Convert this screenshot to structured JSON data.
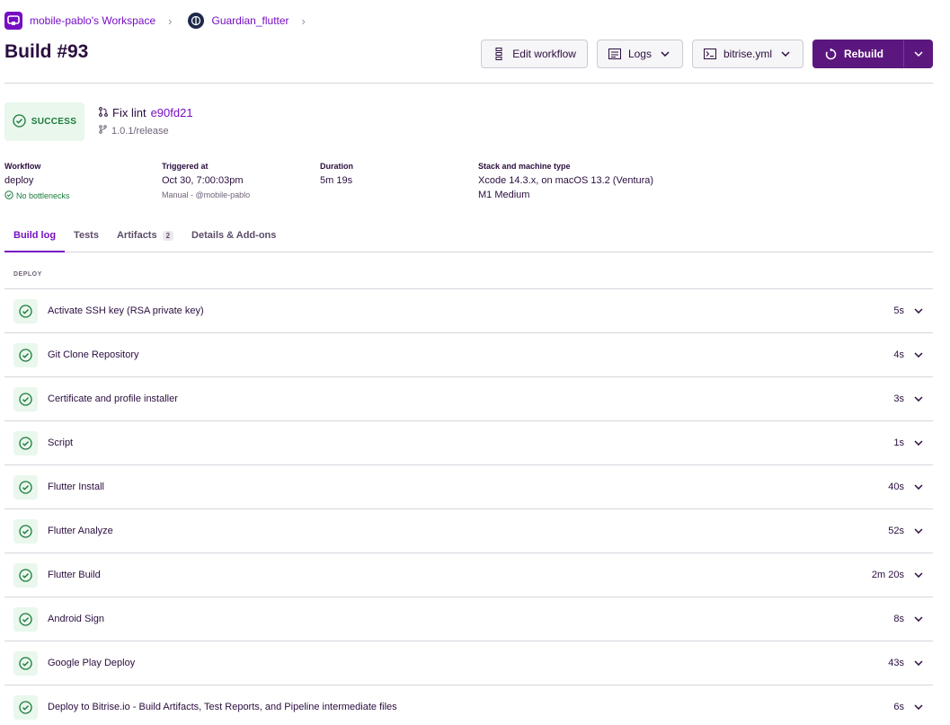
{
  "breadcrumb": {
    "workspace": "mobile-pablo's Workspace",
    "project": "Guardian_flutter"
  },
  "header": {
    "title": "Build #93",
    "edit_workflow": "Edit workflow",
    "logs": "Logs",
    "bitrise_yml": "bitrise.yml",
    "rebuild": "Rebuild"
  },
  "status": {
    "label": "SUCCESS",
    "commit_message": "Fix lint",
    "commit_hash": "e90fd21",
    "branch": "1.0.1/release"
  },
  "meta": {
    "workflow_label": "Workflow",
    "workflow_value": "deploy",
    "workflow_sub": "No bottlenecks",
    "triggered_label": "Triggered at",
    "triggered_value": "Oct 30, 7:00:03pm",
    "triggered_sub": "Manual - @mobile-pablo",
    "duration_label": "Duration",
    "duration_value": "5m 19s",
    "stack_label": "Stack and machine type",
    "stack_value": "Xcode 14.3.x, on macOS 13.2 (Ventura)",
    "machine_value": "M1 Medium"
  },
  "tabs": [
    {
      "label": "Build log",
      "active": true
    },
    {
      "label": "Tests"
    },
    {
      "label": "Artifacts",
      "count": "2"
    },
    {
      "label": "Details & Add-ons"
    }
  ],
  "section_label": "DEPLOY",
  "steps": [
    {
      "name": "Activate SSH key (RSA private key)",
      "duration": "5s"
    },
    {
      "name": "Git Clone Repository",
      "duration": "4s"
    },
    {
      "name": "Certificate and profile installer",
      "duration": "3s"
    },
    {
      "name": "Script",
      "duration": "1s"
    },
    {
      "name": "Flutter Install",
      "duration": "40s"
    },
    {
      "name": "Flutter Analyze",
      "duration": "52s"
    },
    {
      "name": "Flutter Build",
      "duration": "2m 20s"
    },
    {
      "name": "Android Sign",
      "duration": "8s"
    },
    {
      "name": "Google Play Deploy",
      "duration": "43s"
    },
    {
      "name": "Deploy to Bitrise.io - Build Artifacts, Test Reports, and Pipeline intermediate files",
      "duration": "6s"
    }
  ],
  "colors": {
    "brand": "#760fc3",
    "primary_button": "#5c177f",
    "success": "#1a7a3a",
    "success_bg": "#e9f7ec"
  }
}
